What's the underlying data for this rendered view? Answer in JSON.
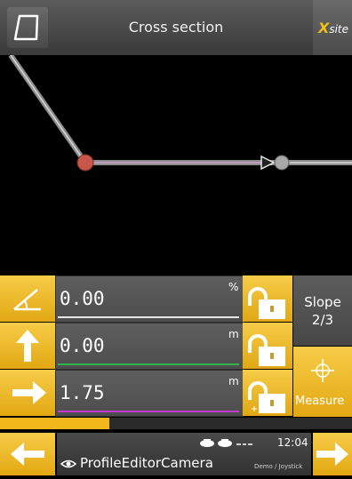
{
  "header": {
    "title": "Cross section",
    "brand_x": "X",
    "brand_rest": "site"
  },
  "rows": [
    {
      "icon": "angle-icon",
      "value": "0.00",
      "unit": "%",
      "underline_color": "#e6e6e6"
    },
    {
      "icon": "arrow-up-icon",
      "value": "0.00",
      "unit": "m",
      "underline_color": "#2fb34a"
    },
    {
      "icon": "arrow-right-icon",
      "value": "1.75",
      "unit": "m",
      "underline_color": "#c23ad0"
    }
  ],
  "slope_button": {
    "line1": "Slope",
    "line2": "2/3"
  },
  "measure_button": {
    "label": "Measure"
  },
  "progress": {
    "fraction": 0.31
  },
  "status": {
    "time": "12:04"
  },
  "footer": {
    "camera_label": "ProfileEditorCamera",
    "mode_label": "Demo / Joystick"
  },
  "colors": {
    "accent": "#f2b81b",
    "header": "#4a4a4a"
  }
}
